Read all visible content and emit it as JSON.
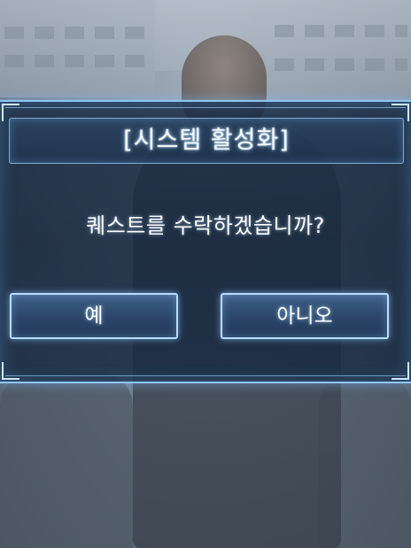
{
  "dialog": {
    "title": "[시스템 활성화]",
    "question": "퀘스트를 수락하겠습니까?",
    "buttons": {
      "yes_label": "예",
      "no_label": "아니오"
    }
  },
  "colors": {
    "frame_glow": "#8fc6f0",
    "panel_bg": "#1c3250",
    "button_bg": "#2a4568",
    "text": "#ffffff"
  }
}
